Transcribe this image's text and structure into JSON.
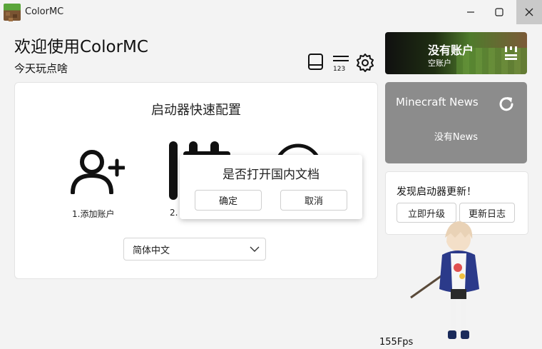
{
  "window": {
    "title": "ColorMC",
    "minimize_icon": "minimize-icon",
    "maximize_icon": "maximize-icon",
    "close_icon": "close-icon"
  },
  "header": {
    "welcome": "欢迎使用ColorMC",
    "subtitle": "今天玩点啥",
    "icons": [
      "book-icon",
      "list-icon",
      "gear-icon"
    ],
    "list_badge": "123"
  },
  "quick_setup": {
    "title": "启动器快速配置",
    "steps": [
      {
        "label": "1.添加账户",
        "icon": "add-user-icon"
      },
      {
        "label": "2.",
        "icon": "sliders-icon"
      },
      {
        "label": "",
        "icon": "help-icon"
      }
    ],
    "language": {
      "value": "简体中文",
      "icon": "chevron-down-icon"
    }
  },
  "dialog": {
    "message": "是否打开国内文档",
    "confirm": "确定",
    "cancel": "取消"
  },
  "account": {
    "name": "没有账户",
    "type": "空账户",
    "icon": "account-settings-icon"
  },
  "news": {
    "title": "Minecraft News",
    "empty": "没有News",
    "icon": "refresh-icon"
  },
  "update": {
    "message": "发现启动器更新！",
    "upgrade": "立即升级",
    "changelog": "更新日志"
  },
  "status": {
    "fps": "155Fps"
  },
  "colors": {
    "background": "#f3f3f3",
    "panel": "#ffffff",
    "news_bg": "#8c8c8c",
    "close_hover": "#c9c9c9"
  }
}
